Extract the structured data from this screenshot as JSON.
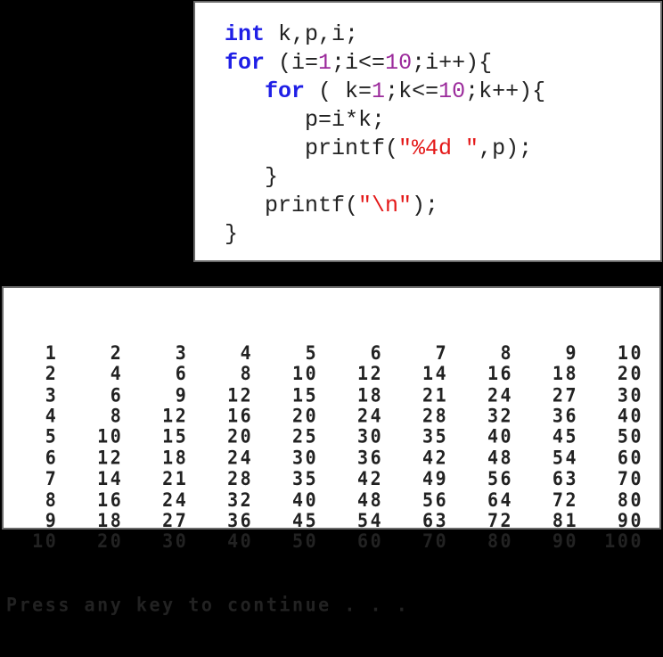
{
  "code": {
    "lines": [
      [
        {
          "t": "int",
          "c": "kw"
        },
        {
          "t": " k,p,i;",
          "c": ""
        }
      ],
      [
        {
          "t": "for",
          "c": "kw"
        },
        {
          "t": " (i=",
          "c": ""
        },
        {
          "t": "1",
          "c": "num"
        },
        {
          "t": ";i<=",
          "c": ""
        },
        {
          "t": "10",
          "c": "num"
        },
        {
          "t": ";i++){",
          "c": ""
        }
      ],
      [
        {
          "t": "   ",
          "c": ""
        },
        {
          "t": "for",
          "c": "kw"
        },
        {
          "t": " ( k=",
          "c": ""
        },
        {
          "t": "1",
          "c": "num"
        },
        {
          "t": ";k<=",
          "c": ""
        },
        {
          "t": "10",
          "c": "num"
        },
        {
          "t": ";k++){",
          "c": ""
        }
      ],
      [
        {
          "t": "      p=i*k;",
          "c": ""
        }
      ],
      [
        {
          "t": "      printf(",
          "c": ""
        },
        {
          "t": "\"%4d \"",
          "c": "str"
        },
        {
          "t": ",p);",
          "c": ""
        }
      ],
      [
        {
          "t": "   }",
          "c": ""
        }
      ],
      [
        {
          "t": "   printf(",
          "c": ""
        },
        {
          "t": "\"\\n\"",
          "c": "str"
        },
        {
          "t": ");",
          "c": ""
        }
      ],
      [
        {
          "t": "}",
          "c": ""
        }
      ]
    ],
    "colors": {
      "keyword": "#1f1fe6",
      "number": "#9b2a9b",
      "string": "#e41818"
    }
  },
  "console": {
    "rows": [
      [
        1,
        2,
        3,
        4,
        5,
        6,
        7,
        8,
        9,
        10
      ],
      [
        2,
        4,
        6,
        8,
        10,
        12,
        14,
        16,
        18,
        20
      ],
      [
        3,
        6,
        9,
        12,
        15,
        18,
        21,
        24,
        27,
        30
      ],
      [
        4,
        8,
        12,
        16,
        20,
        24,
        28,
        32,
        36,
        40
      ],
      [
        5,
        10,
        15,
        20,
        25,
        30,
        35,
        40,
        45,
        50
      ],
      [
        6,
        12,
        18,
        24,
        30,
        36,
        42,
        48,
        54,
        60
      ],
      [
        7,
        14,
        21,
        28,
        35,
        42,
        49,
        56,
        63,
        70
      ],
      [
        8,
        16,
        24,
        32,
        40,
        48,
        56,
        64,
        72,
        80
      ],
      [
        9,
        18,
        27,
        36,
        45,
        54,
        63,
        72,
        81,
        90
      ],
      [
        10,
        20,
        30,
        40,
        50,
        60,
        70,
        80,
        90,
        100
      ]
    ],
    "prompt": "Press any key to continue . . ."
  }
}
